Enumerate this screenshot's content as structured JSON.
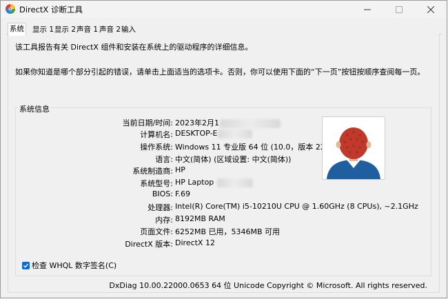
{
  "window": {
    "title": "DirectX 诊断工具",
    "minimize_icon": "minimize-icon",
    "maximize_icon": "maximize-icon",
    "close_icon": "close-icon"
  },
  "tabs": [
    {
      "label": "系统",
      "active": true
    },
    {
      "label": "显示 1",
      "active": false
    },
    {
      "label": "显示 2",
      "active": false
    },
    {
      "label": "声音 1",
      "active": false
    },
    {
      "label": "声音 2",
      "active": false
    },
    {
      "label": "输入",
      "active": false
    }
  ],
  "intro": {
    "line1": "该工具报告有关 DirectX 组件和安装在系统上的驱动程序的详细信息。",
    "line2": "如果你知道是哪个部分引起的错误，请单击上面适当的选项卡。否则，你可以使用下面的“下一页”按钮按顺序查阅每一页。"
  },
  "system_info": {
    "group_title": "系统信息",
    "rows": [
      {
        "label": "当前日期/时间:",
        "value": "2023年2月1"
      },
      {
        "label": "计算机名:",
        "value": "DESKTOP-E"
      },
      {
        "label": "操作系统:",
        "value": "Windows 11 专业版 64 位 (10.0，版本 22000)"
      },
      {
        "label": "语言:",
        "value": "中文(简体) (区域设置: 中文(简体))"
      },
      {
        "label": "系统制造商:",
        "value": "HP"
      },
      {
        "label": "系统型号:",
        "value": "HP Laptop"
      },
      {
        "label": "BIOS:",
        "value": "F.69"
      },
      {
        "label": "处理器:",
        "value": "Intel(R) Core(TM) i5-10210U CPU @ 1.60GHz (8 CPUs), ~2.1GHz"
      },
      {
        "label": "内存:",
        "value": "8192MB RAM"
      },
      {
        "label": "页面文件:",
        "value": "6252MB 已用，5346MB 可用"
      },
      {
        "label": "DirectX 版本:",
        "value": "DirectX 12"
      }
    ]
  },
  "whql_checkbox": {
    "label": "检查 WHQL 数字签名(C)",
    "checked": true
  },
  "footer": {
    "text": "DxDiag 10.00.22000.0653 64 位 Unicode  Copyright © Microsoft. All rights reserved."
  },
  "colors": {
    "checkbox_accent": "#0b6ad3",
    "avatar_hair": "#c0392b",
    "avatar_shirt": "#1f5fa0"
  }
}
